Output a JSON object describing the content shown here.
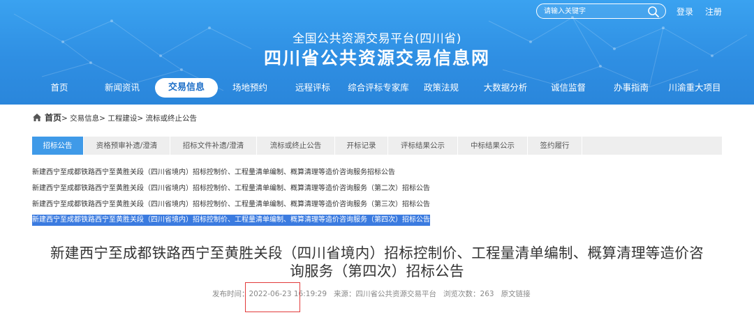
{
  "header": {
    "search_placeholder": "请输入关键字",
    "login": "登录",
    "register": "注册",
    "subtitle": "全国公共资源交易平台(四川省)",
    "title": "四川省公共资源交易信息网"
  },
  "nav": {
    "items": [
      "首页",
      "新闻资讯",
      "交易信息",
      "场地预约",
      "远程评标",
      "综合评标专家库",
      "政策法规",
      "大数据分析",
      "诚信监督",
      "办事指南",
      "川渝重大项目"
    ],
    "active": "交易信息"
  },
  "breadcrumb": {
    "home": "首页",
    "separator": ">",
    "items": [
      "交易信息",
      "工程建设",
      "流标或终止公告"
    ]
  },
  "tabs": {
    "items": [
      "招标公告",
      "资格预审补遗/澄清",
      "招标文件补遗/澄清",
      "流标或终止公告",
      "开标记录",
      "评标结果公示",
      "中标结果公示",
      "签约履行"
    ],
    "active": "招标公告"
  },
  "list": [
    "新建西宁至成都铁路西宁至黄胜关段（四川省境内）招标控制价、工程量清单编制、概算清理等造价咨询服务招标公告",
    "新建西宁至成都铁路西宁至黄胜关段（四川省境内）招标控制价、工程量清单编制、概算清理等造价咨询服务（第二次）招标公告",
    "新建西宁至成都铁路西宁至黄胜关段（四川省境内）招标控制价、工程量清单编制、概算清理等造价咨询服务（第三次）招标公告",
    "新建西宁至成都铁路西宁至黄胜关段（四川省境内）招标控制价、工程量清单编制、概算清理等造价咨询服务（第四次）招标公告"
  ],
  "article": {
    "title_line1": "新建西宁至成都铁路西宁至黄胜关段（四川省境内）招标控制价、工程量清单编制、概算清理等造价咨",
    "title_line2": "询服务（第四次）招标公告",
    "publish_label": "发布时间：",
    "publish_time": "2022-06-23 16:19:29",
    "source": "来源：四川省公共资源交易平台",
    "views": "浏览次数：263",
    "original_link": "原文链接"
  },
  "colors": {
    "header_blue": "#2f8fe3",
    "tab_active": "#3f9ae8",
    "selection": "#3b7be0",
    "highlight_red": "#e23a3a"
  }
}
